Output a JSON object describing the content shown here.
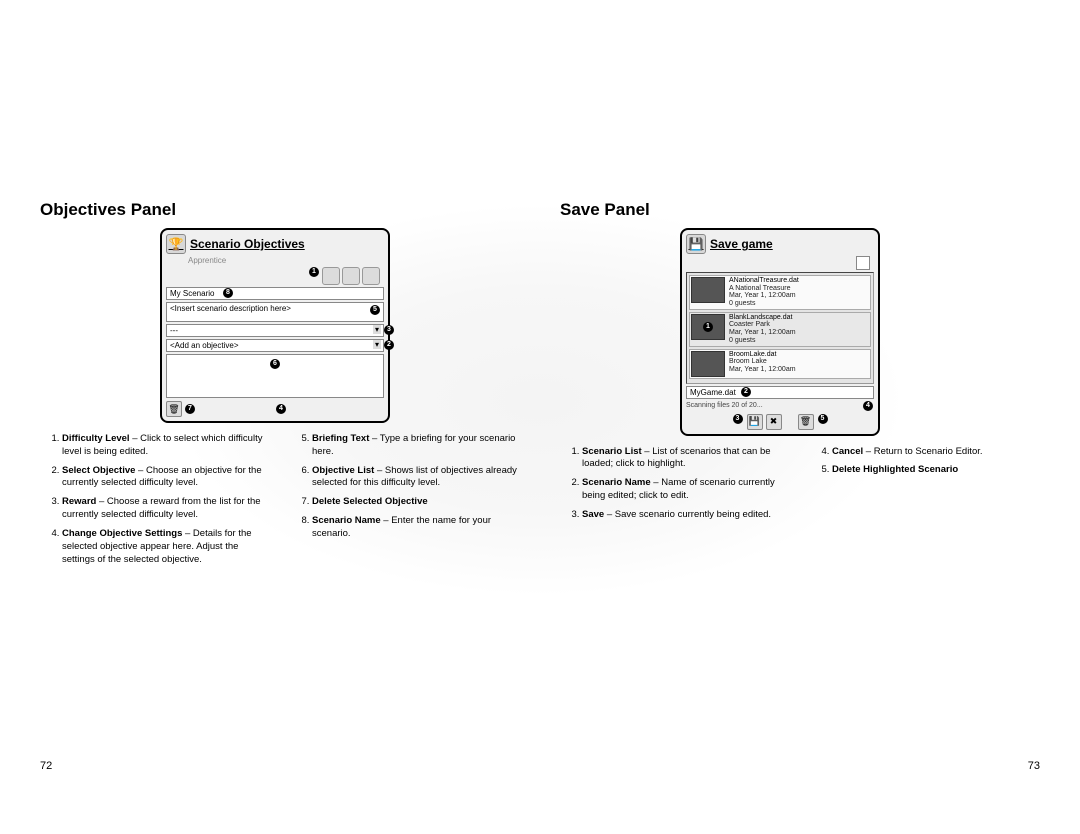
{
  "left": {
    "heading": "Objectives Panel",
    "panel": {
      "title": "Scenario Objectives",
      "subtitle": "Apprentice",
      "my_scenario": "My Scenario",
      "desc_placeholder": "<Insert scenario description here>",
      "dashes": "---",
      "add_objective": "<Add an objective>",
      "callouts": [
        "1",
        "2",
        "3",
        "4",
        "5",
        "6",
        "7",
        "8"
      ]
    },
    "legend_a": [
      {
        "num": "1.",
        "bold": "Difficulty Level",
        "text": " – Click to select which difficulty level is being edited."
      },
      {
        "num": "2.",
        "bold": "Select Objective",
        "text": " – Choose an objective for the currently selected difficulty level."
      },
      {
        "num": "3.",
        "bold": "Reward",
        "text": " – Choose a reward from the list for the currently selected difficulty level."
      },
      {
        "num": "4.",
        "bold": "Change Objective Settings",
        "text": " – Details for the selected objective appear here. Adjust the settings of the selected objective."
      }
    ],
    "legend_b": [
      {
        "num": "5.",
        "bold": "Briefing Text",
        "text": " – Type a briefing for your scenario here."
      },
      {
        "num": "6.",
        "bold": "Objective List",
        "text": " – Shows list of objectives already selected for this difficulty level."
      },
      {
        "num": "7.",
        "bold": "Delete Selected Objective",
        "text": ""
      },
      {
        "num": "8.",
        "bold": "Scenario Name",
        "text": " – Enter the name for your scenario."
      }
    ],
    "page_number": "72"
  },
  "right": {
    "heading": "Save Panel",
    "panel": {
      "title": "Save game",
      "list": [
        {
          "file": "ANationalTreasure.dat",
          "name": "A National Treasure",
          "date": "Mar, Year 1, 12:00am",
          "guests": "0 guests"
        },
        {
          "file": "BlankLandscape.dat",
          "name": "Coaster Park",
          "date": "Mar, Year 1, 12:00am",
          "guests": "0 guests",
          "selected": true,
          "callout": "1"
        },
        {
          "file": "BroomLake.dat",
          "name": "Broom Lake",
          "date": "Mar, Year 1, 12:00am",
          "guests": ""
        }
      ],
      "filename": "MyGame.dat",
      "status": "Scanning files 20 of 20...",
      "callouts_bottom": [
        "3",
        "4",
        "5"
      ],
      "callout_filename": "2"
    },
    "legend_a": [
      {
        "num": "1.",
        "bold": "Scenario List",
        "text": " – List of scenarios that can be loaded; click to highlight."
      },
      {
        "num": "2.",
        "bold": "Scenario Name",
        "text": " – Name of scenario currently being edited; click to edit."
      },
      {
        "num": "3.",
        "bold": "Save",
        "text": " – Save scenario currently being edited."
      }
    ],
    "legend_b": [
      {
        "num": "4.",
        "bold": "Cancel",
        "text": " – Return to Scenario Editor."
      },
      {
        "num": "5.",
        "bold": "Delete Highlighted Scenario",
        "text": ""
      }
    ],
    "page_number": "73"
  }
}
